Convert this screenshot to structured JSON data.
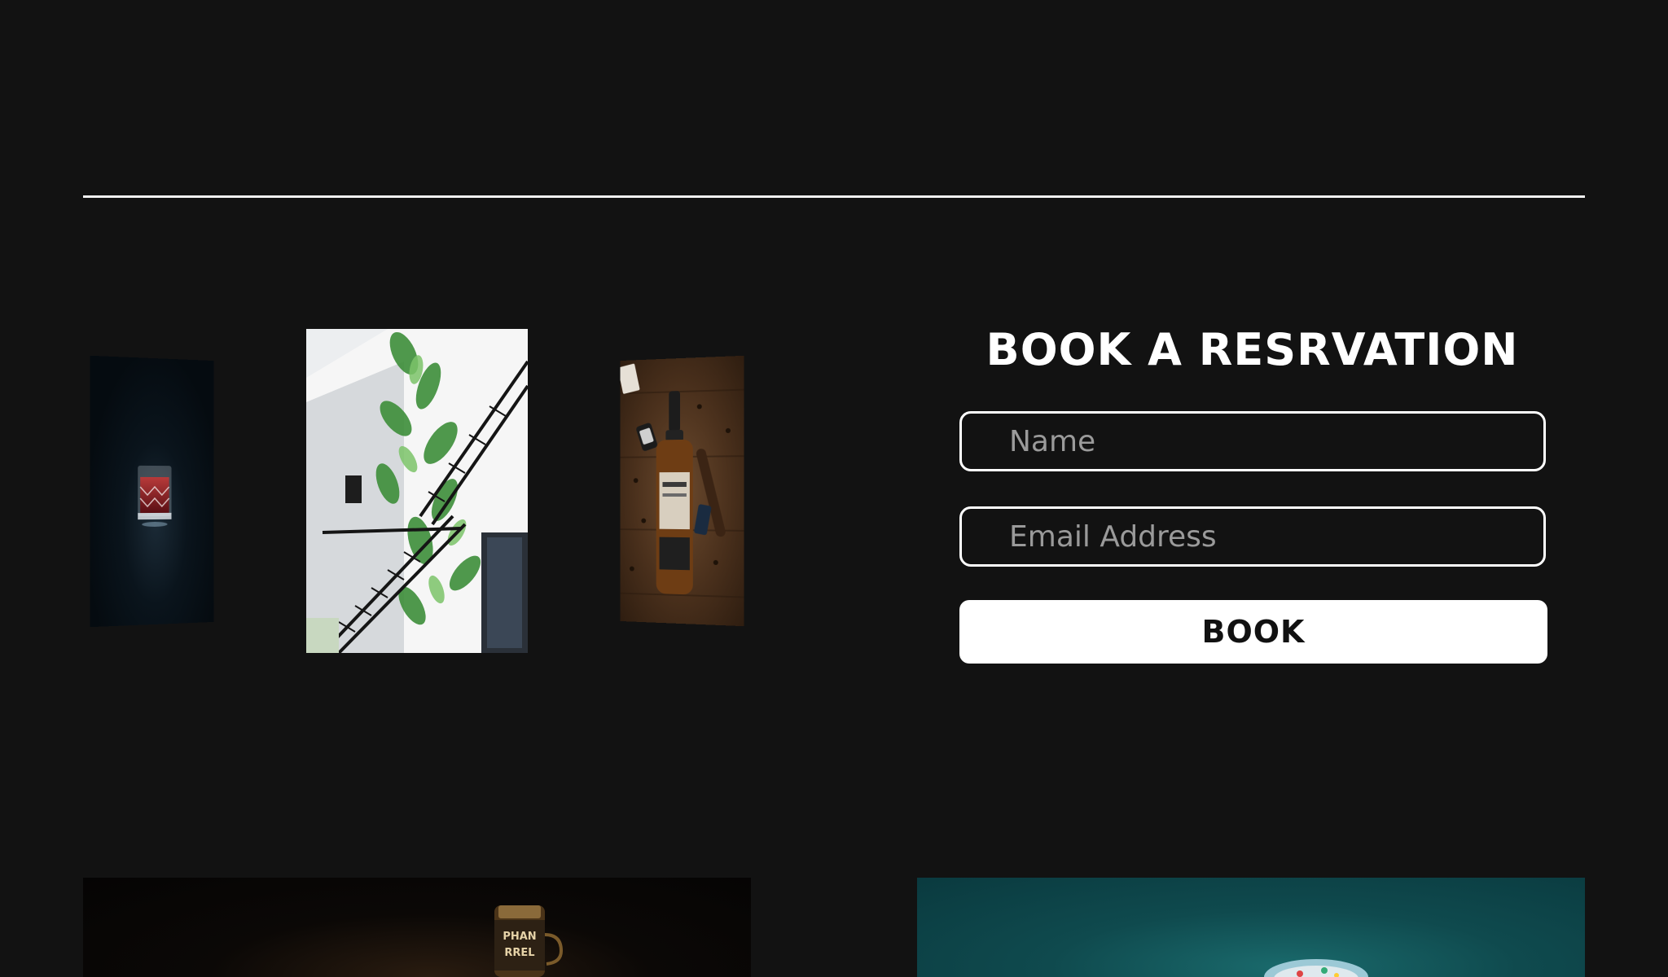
{
  "booking": {
    "title": "BOOK A RESRVATION",
    "name_placeholder": "Name",
    "email_placeholder": "Email Address",
    "submit_label": "BOOK"
  },
  "bottom_image_left": {
    "label_line1": "PHAN",
    "label_line2": "RREL"
  },
  "colors": {
    "background": "#121212",
    "accent": "#ffffff"
  }
}
